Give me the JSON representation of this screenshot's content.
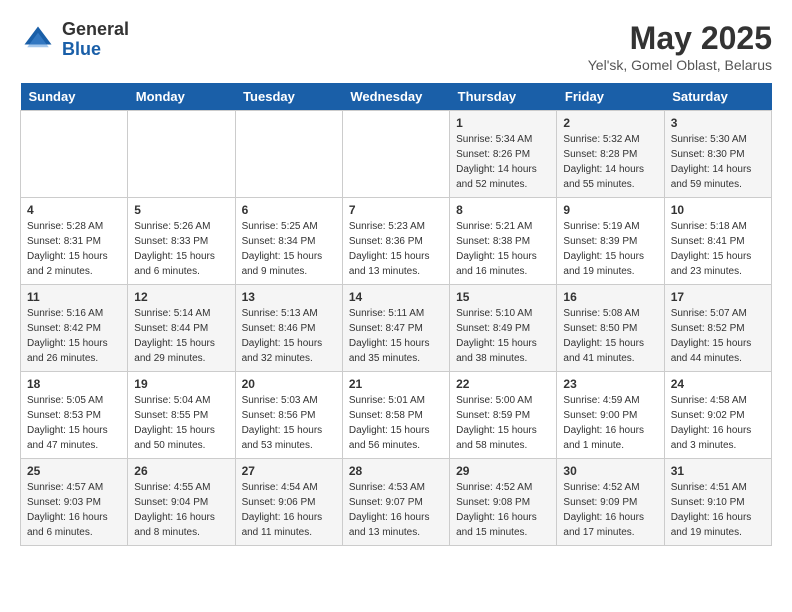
{
  "header": {
    "logo": {
      "general": "General",
      "blue": "Blue"
    },
    "title": "May 2025",
    "subtitle": "Yel'sk, Gomel Oblast, Belarus"
  },
  "days_of_week": [
    "Sunday",
    "Monday",
    "Tuesday",
    "Wednesday",
    "Thursday",
    "Friday",
    "Saturday"
  ],
  "weeks": [
    [
      {
        "day": "",
        "info": ""
      },
      {
        "day": "",
        "info": ""
      },
      {
        "day": "",
        "info": ""
      },
      {
        "day": "",
        "info": ""
      },
      {
        "day": "1",
        "info": "Sunrise: 5:34 AM\nSunset: 8:26 PM\nDaylight: 14 hours\nand 52 minutes."
      },
      {
        "day": "2",
        "info": "Sunrise: 5:32 AM\nSunset: 8:28 PM\nDaylight: 14 hours\nand 55 minutes."
      },
      {
        "day": "3",
        "info": "Sunrise: 5:30 AM\nSunset: 8:30 PM\nDaylight: 14 hours\nand 59 minutes."
      }
    ],
    [
      {
        "day": "4",
        "info": "Sunrise: 5:28 AM\nSunset: 8:31 PM\nDaylight: 15 hours\nand 2 minutes."
      },
      {
        "day": "5",
        "info": "Sunrise: 5:26 AM\nSunset: 8:33 PM\nDaylight: 15 hours\nand 6 minutes."
      },
      {
        "day": "6",
        "info": "Sunrise: 5:25 AM\nSunset: 8:34 PM\nDaylight: 15 hours\nand 9 minutes."
      },
      {
        "day": "7",
        "info": "Sunrise: 5:23 AM\nSunset: 8:36 PM\nDaylight: 15 hours\nand 13 minutes."
      },
      {
        "day": "8",
        "info": "Sunrise: 5:21 AM\nSunset: 8:38 PM\nDaylight: 15 hours\nand 16 minutes."
      },
      {
        "day": "9",
        "info": "Sunrise: 5:19 AM\nSunset: 8:39 PM\nDaylight: 15 hours\nand 19 minutes."
      },
      {
        "day": "10",
        "info": "Sunrise: 5:18 AM\nSunset: 8:41 PM\nDaylight: 15 hours\nand 23 minutes."
      }
    ],
    [
      {
        "day": "11",
        "info": "Sunrise: 5:16 AM\nSunset: 8:42 PM\nDaylight: 15 hours\nand 26 minutes."
      },
      {
        "day": "12",
        "info": "Sunrise: 5:14 AM\nSunset: 8:44 PM\nDaylight: 15 hours\nand 29 minutes."
      },
      {
        "day": "13",
        "info": "Sunrise: 5:13 AM\nSunset: 8:46 PM\nDaylight: 15 hours\nand 32 minutes."
      },
      {
        "day": "14",
        "info": "Sunrise: 5:11 AM\nSunset: 8:47 PM\nDaylight: 15 hours\nand 35 minutes."
      },
      {
        "day": "15",
        "info": "Sunrise: 5:10 AM\nSunset: 8:49 PM\nDaylight: 15 hours\nand 38 minutes."
      },
      {
        "day": "16",
        "info": "Sunrise: 5:08 AM\nSunset: 8:50 PM\nDaylight: 15 hours\nand 41 minutes."
      },
      {
        "day": "17",
        "info": "Sunrise: 5:07 AM\nSunset: 8:52 PM\nDaylight: 15 hours\nand 44 minutes."
      }
    ],
    [
      {
        "day": "18",
        "info": "Sunrise: 5:05 AM\nSunset: 8:53 PM\nDaylight: 15 hours\nand 47 minutes."
      },
      {
        "day": "19",
        "info": "Sunrise: 5:04 AM\nSunset: 8:55 PM\nDaylight: 15 hours\nand 50 minutes."
      },
      {
        "day": "20",
        "info": "Sunrise: 5:03 AM\nSunset: 8:56 PM\nDaylight: 15 hours\nand 53 minutes."
      },
      {
        "day": "21",
        "info": "Sunrise: 5:01 AM\nSunset: 8:58 PM\nDaylight: 15 hours\nand 56 minutes."
      },
      {
        "day": "22",
        "info": "Sunrise: 5:00 AM\nSunset: 8:59 PM\nDaylight: 15 hours\nand 58 minutes."
      },
      {
        "day": "23",
        "info": "Sunrise: 4:59 AM\nSunset: 9:00 PM\nDaylight: 16 hours\nand 1 minute."
      },
      {
        "day": "24",
        "info": "Sunrise: 4:58 AM\nSunset: 9:02 PM\nDaylight: 16 hours\nand 3 minutes."
      }
    ],
    [
      {
        "day": "25",
        "info": "Sunrise: 4:57 AM\nSunset: 9:03 PM\nDaylight: 16 hours\nand 6 minutes."
      },
      {
        "day": "26",
        "info": "Sunrise: 4:55 AM\nSunset: 9:04 PM\nDaylight: 16 hours\nand 8 minutes."
      },
      {
        "day": "27",
        "info": "Sunrise: 4:54 AM\nSunset: 9:06 PM\nDaylight: 16 hours\nand 11 minutes."
      },
      {
        "day": "28",
        "info": "Sunrise: 4:53 AM\nSunset: 9:07 PM\nDaylight: 16 hours\nand 13 minutes."
      },
      {
        "day": "29",
        "info": "Sunrise: 4:52 AM\nSunset: 9:08 PM\nDaylight: 16 hours\nand 15 minutes."
      },
      {
        "day": "30",
        "info": "Sunrise: 4:52 AM\nSunset: 9:09 PM\nDaylight: 16 hours\nand 17 minutes."
      },
      {
        "day": "31",
        "info": "Sunrise: 4:51 AM\nSunset: 9:10 PM\nDaylight: 16 hours\nand 19 minutes."
      }
    ]
  ]
}
